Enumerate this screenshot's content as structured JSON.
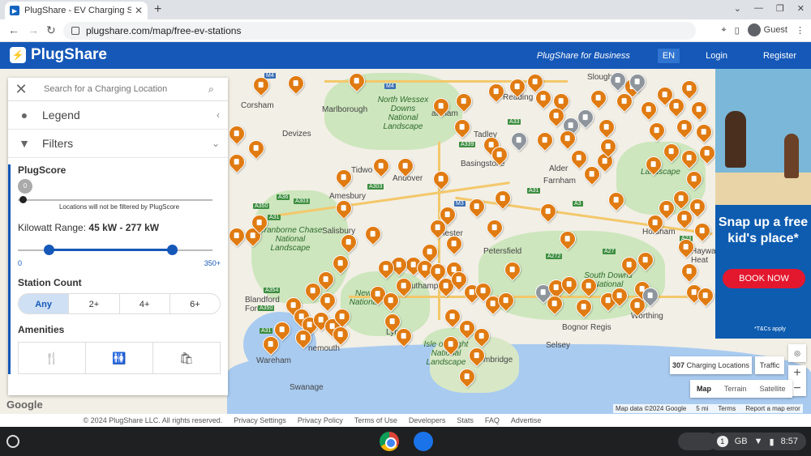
{
  "browser": {
    "tab_title": "PlugShare - EV Charging Statio",
    "url": "plugshare.com/map/free-ev-stations",
    "profile": "Guest"
  },
  "header": {
    "brand": "PlugShare",
    "business": "PlugShare for Business",
    "lang": "EN",
    "login": "Login",
    "register": "Register"
  },
  "sidebar": {
    "search_placeholder": "Search for a Charging Location",
    "legend": "Legend",
    "filters": "Filters",
    "plugscore_label": "PlugScore",
    "plugscore_value": "0",
    "plugscore_note": "Locations will not be filtered by PlugScore",
    "kw_label": "Kilowatt Range:",
    "kw_value": "45 kW - 277 kW",
    "kw_min": "0",
    "kw_max": "350+",
    "station_count_label": "Station Count",
    "station_count_options": [
      "Any",
      "2+",
      "4+",
      "6+"
    ],
    "amenities_label": "Amenities"
  },
  "map": {
    "places": {
      "corsham": "Corsham",
      "marlborough": "Marlborough",
      "devizes": "Devizes",
      "reading": "Reading",
      "slough": "Slough",
      "tadley": "Tadley",
      "basingstoke": "Basingstoke",
      "andover": "Andover",
      "tidworth": "Tidwo",
      "amesbury": "Amesbury",
      "aldershot": "Alder",
      "farnham": "Farnham",
      "salisbury": "Salisbury",
      "winchester": "chester",
      "petersfield": "Petersfield",
      "horsham": "Horsham",
      "southampton": "uthamp",
      "blandford": "Blandford Forum",
      "wareham": "Wareham",
      "bournemouth": "nemouth",
      "swanage": "Swanage",
      "lymington": "Lym",
      "bognor": "Bognor Regis",
      "selsey": "Selsey",
      "worthing": "Worthing",
      "hayward": "Haywar Heat",
      "pembridge": "mbridge",
      "chatham": "atcham",
      "aldershot_region": "Alder"
    },
    "parks": {
      "north_wessex": "North Wessex Downs National Landscape",
      "cranborne": "Cranborne Chase National Landscape",
      "new_forest": "New Nationa",
      "south_downs": "South Downs National",
      "surrey": "Landscape",
      "isle_of_wight": "Isle of Wight National Landscape"
    },
    "roads": [
      "M4",
      "M4",
      "A33",
      "A339",
      "A303",
      "A36",
      "A350",
      "A303",
      "A31",
      "A354",
      "A27",
      "A272",
      "A31",
      "M3",
      "A3",
      "A23",
      "A31",
      "A350"
    ],
    "attribution": "Map data ©2024 Google",
    "scale": "5 mi",
    "terms": "Terms",
    "report": "Report a map error",
    "google": "Google"
  },
  "controls": {
    "locations_count": "307",
    "locations_label": "Charging Locations",
    "traffic": "Traffic",
    "map_types": [
      "Map",
      "Terrain",
      "Satellite"
    ]
  },
  "ad": {
    "headline": "Snap up a free kid's place*",
    "cta": "BOOK NOW",
    "tc": "*T&Cs apply"
  },
  "footer": {
    "copyright": "© 2024 PlugShare LLC. All rights reserved.",
    "links": [
      "Privacy Settings",
      "Privacy Policy",
      "Terms of Use",
      "Developers",
      "Stats",
      "FAQ",
      "Advertise"
    ]
  },
  "shelf": {
    "network": "GB",
    "notifications": "1",
    "time": "8:57"
  },
  "colors": {
    "brand_blue": "#1558b8",
    "pin_orange": "#e07b12",
    "pin_grey": "#8e959c",
    "ad_red": "#e3182e"
  }
}
